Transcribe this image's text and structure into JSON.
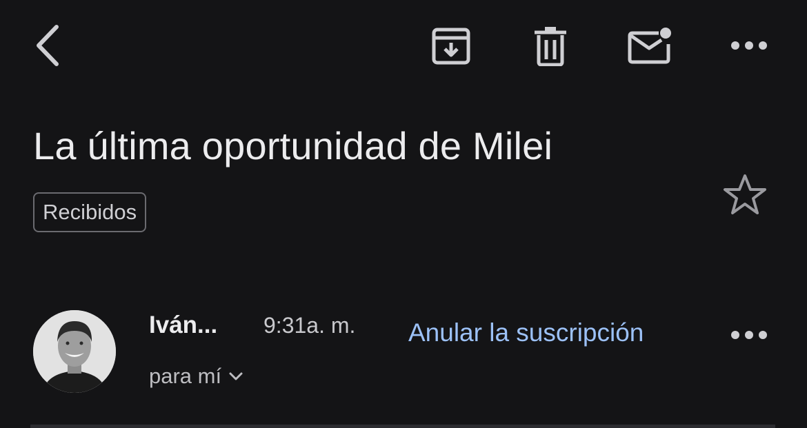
{
  "toolbar": {
    "back_icon": "chevron-left-icon",
    "archive_icon": "archive-icon",
    "delete_icon": "trash-icon",
    "mark_unread_icon": "mail-unread-icon",
    "more_icon": "more-horizontal-icon"
  },
  "email": {
    "subject": "La última oportunidad de Milei",
    "label": "Recibidos",
    "starred": false
  },
  "message": {
    "sender": "Iván...",
    "time": "9:31a. m.",
    "unsubscribe": "Anular la suscripción",
    "recipient": "para mí"
  },
  "colors": {
    "background": "#141416",
    "text": "#ececee",
    "link": "#9cc1f7",
    "chip_border": "#6b6b70"
  }
}
